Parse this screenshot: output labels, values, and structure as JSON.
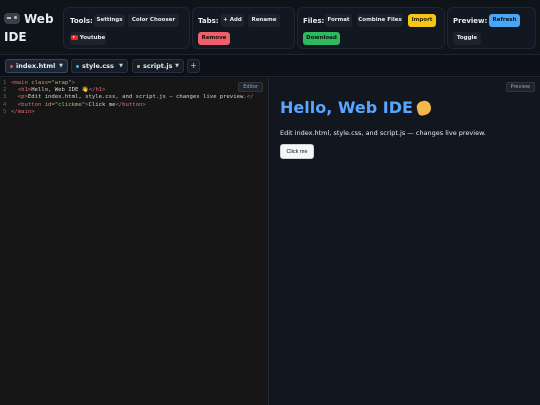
{
  "app": {
    "title": "Web IDE"
  },
  "toolbar": {
    "tools": {
      "label": "Tools:",
      "settings": "Settings",
      "color_chooser": "Color Chooser",
      "youtube": "Youtube"
    },
    "tabs": {
      "label": "Tabs:",
      "add": "+ Add",
      "rename": "Rename",
      "remove": "Remove"
    },
    "files": {
      "label": "Files:",
      "format": "Format",
      "combine": "Combine Files",
      "import": "Import",
      "download": "Download"
    },
    "preview": {
      "label": "Preview:",
      "refresh": "Refresh",
      "toggle": "Toggle"
    }
  },
  "file_tabs": [
    {
      "name": "index.html",
      "caret": "▼",
      "dot_color": "#e5534b",
      "active": true
    },
    {
      "name": "style.css",
      "caret": "▼",
      "dot_color": "#3fb9d6",
      "active": false
    },
    {
      "name": "script.js",
      "caret": "▼",
      "dot_color": "#e3b341",
      "active": false
    }
  ],
  "add_tab": "+",
  "editor": {
    "badge": "Editor",
    "lines": [
      {
        "n": "1",
        "parts": [
          [
            "tag",
            "<main "
          ],
          [
            "attr",
            "class="
          ],
          [
            "str",
            "\"wrap\""
          ],
          [
            "tag",
            ">"
          ]
        ]
      },
      {
        "n": "2",
        "parts": [
          [
            "tag",
            "  <h1>"
          ],
          [
            "txt",
            "Hello, Web IDE 👋"
          ],
          [
            "tag",
            "</h1>"
          ]
        ]
      },
      {
        "n": "3",
        "parts": [
          [
            "tag",
            "  <p>"
          ],
          [
            "txt",
            "Edit index.html, style.css, and script.js — changes live preview."
          ],
          [
            "tag",
            "</"
          ]
        ]
      },
      {
        "n": "4",
        "parts": [
          [
            "tag",
            "  <button "
          ],
          [
            "attr",
            "id="
          ],
          [
            "str",
            "\"clickme\""
          ],
          [
            "tag",
            ">"
          ],
          [
            "txt",
            "Click me"
          ],
          [
            "tag",
            "</button>"
          ]
        ]
      },
      {
        "n": "5",
        "parts": [
          [
            "tag",
            "</main>"
          ]
        ]
      }
    ]
  },
  "preview": {
    "badge": "Preview",
    "heading": "Hello, Web IDE",
    "text": "Edit index.html, style.css, and script.js — changes live preview.",
    "button": "Click me"
  }
}
